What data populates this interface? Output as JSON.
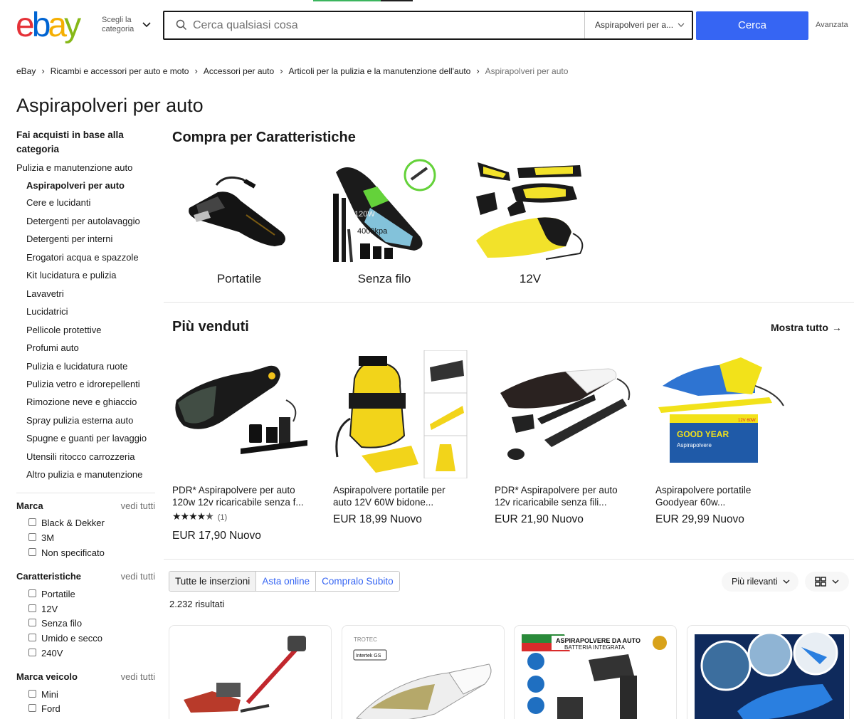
{
  "header": {
    "logo_letters": [
      "e",
      "b",
      "a",
      "y"
    ],
    "logo_colors": [
      "#e53238",
      "#0064d2",
      "#f5af02",
      "#86b817"
    ],
    "category_selector": "Scegli la categoria",
    "search_placeholder": "Cerca qualsiasi cosa",
    "search_category": "Aspirapolveri per a...",
    "search_button": "Cerca",
    "advanced_link": "Avanzata",
    "accent_blue": "#3665f3"
  },
  "breadcrumb": [
    "eBay",
    "Ricambi e accessori per auto e moto",
    "Accessori per auto",
    "Articoli per la pulizia e la manutenzione dell'auto",
    "Aspirapolveri per auto"
  ],
  "page_title": "Aspirapolveri per auto",
  "sidebar": {
    "category_heading": "Fai acquisti in base alla categoria",
    "parent_category": "Pulizia e manutenzione auto",
    "categories": [
      "Aspirapolveri per auto",
      "Cere e lucidanti",
      "Detergenti per autolavaggio",
      "Detergenti per interni",
      "Erogatori acqua e spazzole",
      "Kit lucidatura e pulizia",
      "Lavavetri",
      "Lucidatrici",
      "Pellicole protettive",
      "Profumi auto",
      "Pulizia e lucidatura ruote",
      "Pulizia vetro e idrorepellenti",
      "Rimozione neve e ghiaccio",
      "Spray pulizia esterna auto",
      "Spugne e guanti per lavaggio",
      "Utensili ritocco carrozzeria",
      "Altro pulizia e manutenzione"
    ],
    "filters": [
      {
        "title": "Marca",
        "see_all": "vedi tutti",
        "options": [
          "Black & Dekker",
          "3M",
          "Non specificato"
        ]
      },
      {
        "title": "Caratteristiche",
        "see_all": "vedi tutti",
        "options": [
          "Portatile",
          "12V",
          "Senza filo",
          "Umido e secco",
          "240V"
        ]
      },
      {
        "title": "Marca veicolo",
        "see_all": "vedi tutti",
        "options": [
          "Mini",
          "Ford"
        ]
      }
    ]
  },
  "features": {
    "title": "Compra per Caratteristiche",
    "tiles": [
      {
        "label": "Portatile",
        "icon": "handheld-vacuum-image"
      },
      {
        "label": "Senza filo",
        "icon": "cordless-vacuum-image"
      },
      {
        "label": "12V",
        "icon": "12v-vacuum-image"
      }
    ],
    "image_texts": {
      "power": "120W",
      "suction": "4000kpa"
    }
  },
  "best_sellers": {
    "title": "Più venduti",
    "see_all": "Mostra tutto",
    "items": [
      {
        "title_line1": "PDR* Aspirapolvere per auto",
        "title_line2": "120w 12v ricaricabile senza f...",
        "rating": 4.5,
        "reviews": "(1)",
        "price": "EUR 17,90 Nuovo"
      },
      {
        "title_line1": "Aspirapolvere portatile per",
        "title_line2": "auto 12V 60W bidone...",
        "price": "EUR 18,99 Nuovo"
      },
      {
        "title_line1": "PDR* Aspirapolvere per auto",
        "title_line2": "12v ricaricabile senza fili...",
        "price": "EUR 21,90 Nuovo"
      },
      {
        "title_line1": "Aspirapolvere portatile",
        "title_line2": "Goodyear 60w...",
        "price": "EUR 29,99 Nuovo"
      }
    ],
    "image_texts": {
      "box_brand": "GOOD YEAR",
      "box_subtitle": "Aspirapolvere",
      "box_badge": "12V 60W"
    }
  },
  "listing": {
    "tabs": [
      "Tutte le inserzioni",
      "Asta online",
      "Compralo Subito"
    ],
    "active_tab": 0,
    "sort": "Più rilevanti",
    "results": "2.232 risultati",
    "card_texts": {
      "brand": "TROTEC",
      "cert": "Intertek GS",
      "banner_line1": "ASPIRAPOLVERE DA AUTO",
      "banner_line2": "BATTERIA INTEGRATA"
    }
  }
}
